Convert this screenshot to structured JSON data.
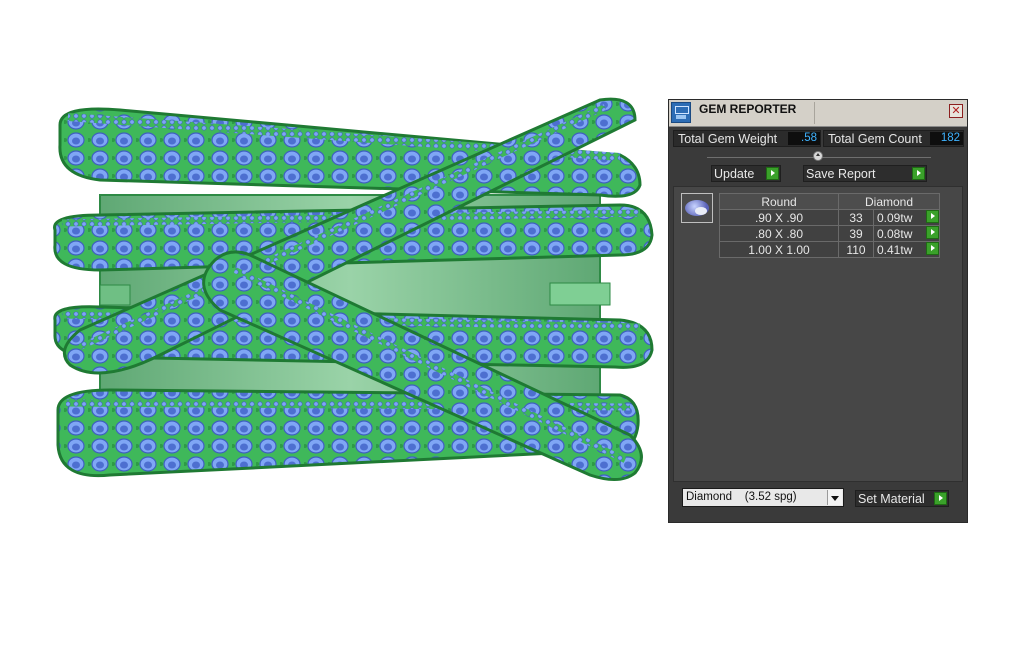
{
  "panel": {
    "title": "GEM REPORTER",
    "close_glyph": "✕",
    "total_weight_label": "Total Gem Weight",
    "total_weight_value": ".58",
    "total_count_label": "Total Gem Count",
    "total_count_value": "182",
    "update_label": "Update",
    "save_label": "Save Report",
    "table": {
      "headers": [
        "Round",
        "Diamond"
      ],
      "rows": [
        {
          "size": ".90 X .90",
          "count": "33",
          "weight": "0.09tw"
        },
        {
          "size": ".80 X .80",
          "count": "39",
          "weight": "0.08tw"
        },
        {
          "size": "1.00 X 1.00",
          "count": "110",
          "weight": "0.41tw"
        }
      ]
    },
    "material_value": "Diamond    (3.52 spg)",
    "set_material_label": "Set Material"
  },
  "colors": {
    "metal": "#3fb85a",
    "metal_dark": "#1f7a33",
    "gem": "#7fa6f5",
    "gem_dark": "#3e5fbf",
    "stat_value": "#3fb3ff",
    "go_button": "#3aa12a"
  },
  "icons": [
    "gem-reporter-app-icon",
    "close-icon",
    "play-arrow-icon",
    "dropdown-arrow-icon",
    "round-gem-icon"
  ]
}
